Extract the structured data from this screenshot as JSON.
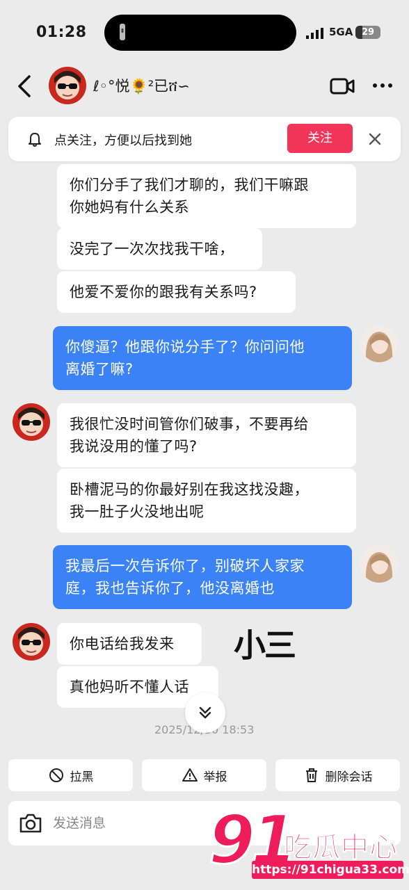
{
  "status_bar": {
    "time": "01:28",
    "network": "5GA",
    "battery": "29"
  },
  "header": {
    "contact_name": "ℓ◦°悦🌻²已ሸ∽"
  },
  "follow_banner": {
    "text": "点关注，方便以后找到她",
    "button": "关注"
  },
  "messages": [
    {
      "side": "in",
      "lines": [
        "你们分手了我们才聊的，我们干嘛跟",
        "你她妈有什么关系"
      ]
    },
    {
      "side": "in",
      "lines": [
        "没完了一次次找我干啥，"
      ]
    },
    {
      "side": "in",
      "lines": [
        "他爱不爱你的跟我有关系吗?"
      ]
    },
    {
      "side": "out",
      "lines": [
        "你傻逼？他跟你说分手了？你问问他",
        "离婚了嘛?"
      ]
    },
    {
      "side": "in",
      "lines": [
        "我很忙没时间管你们破事，不要再给",
        "我说没用的懂了吗?"
      ]
    },
    {
      "side": "in",
      "lines": [
        "卧槽泥马的你最好别在我这找没趣，",
        "我一肚子火没地出呢"
      ]
    },
    {
      "side": "out",
      "lines": [
        "我最后一次告诉你了，别破坏人家家",
        "庭，我也告诉你了，他没离婚也"
      ]
    },
    {
      "side": "in",
      "lines": [
        "你电话给我发来"
      ]
    },
    {
      "side": "in",
      "lines": [
        "真他妈听不懂人话"
      ]
    }
  ],
  "annotation": "小三",
  "timestamp": "2025/12/30 18:53",
  "actions": {
    "block": "拉黑",
    "report": "举报",
    "delete": "删除会话"
  },
  "input": {
    "placeholder": "发送消息"
  },
  "watermark": {
    "brand_number": "91",
    "brand_name": "吃瓜中心",
    "url": "https://91chigua33.com"
  }
}
